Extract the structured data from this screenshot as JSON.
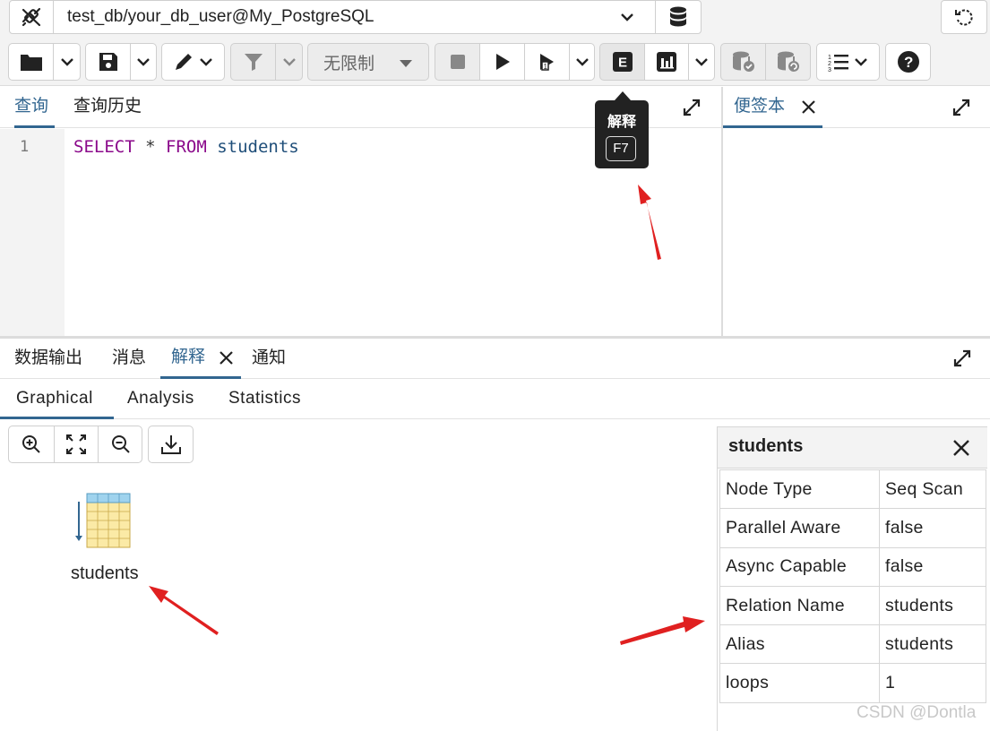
{
  "connection": {
    "label": "test_db/your_db_user@My_PostgreSQL"
  },
  "toolbar": {
    "limit_label": "无限制",
    "tooltip": {
      "label": "解释",
      "shortcut": "F7"
    }
  },
  "query_panel": {
    "tabs": [
      {
        "label": "查询",
        "active": true
      },
      {
        "label": "查询历史",
        "active": false
      }
    ],
    "line_number": "1",
    "sql": {
      "keyword1": "SELECT",
      "star": "*",
      "keyword2": "FROM",
      "table": "students"
    }
  },
  "scratch_panel": {
    "tab_label": "便签本"
  },
  "results_panel": {
    "tabs": [
      {
        "label": "数据输出"
      },
      {
        "label": "消息"
      },
      {
        "label": "解释",
        "active": true,
        "closable": true
      },
      {
        "label": "通知"
      }
    ],
    "subtabs": [
      {
        "label": "Graphical",
        "active": true
      },
      {
        "label": "Analysis"
      },
      {
        "label": "Statistics"
      }
    ],
    "node_label": "students"
  },
  "details": {
    "title": "students",
    "rows": [
      {
        "key": "Node Type",
        "value": "Seq Scan"
      },
      {
        "key": "Parallel Aware",
        "value": "false"
      },
      {
        "key": "Async Capable",
        "value": "false"
      },
      {
        "key": "Relation Name",
        "value": "students"
      },
      {
        "key": "Alias",
        "value": "students"
      },
      {
        "key": "loops",
        "value": "1"
      }
    ]
  },
  "watermark": "CSDN @Dontla",
  "colors": {
    "accent": "#326690",
    "keyword": "#8b0a8b",
    "annotation_arrow": "#e02020"
  }
}
